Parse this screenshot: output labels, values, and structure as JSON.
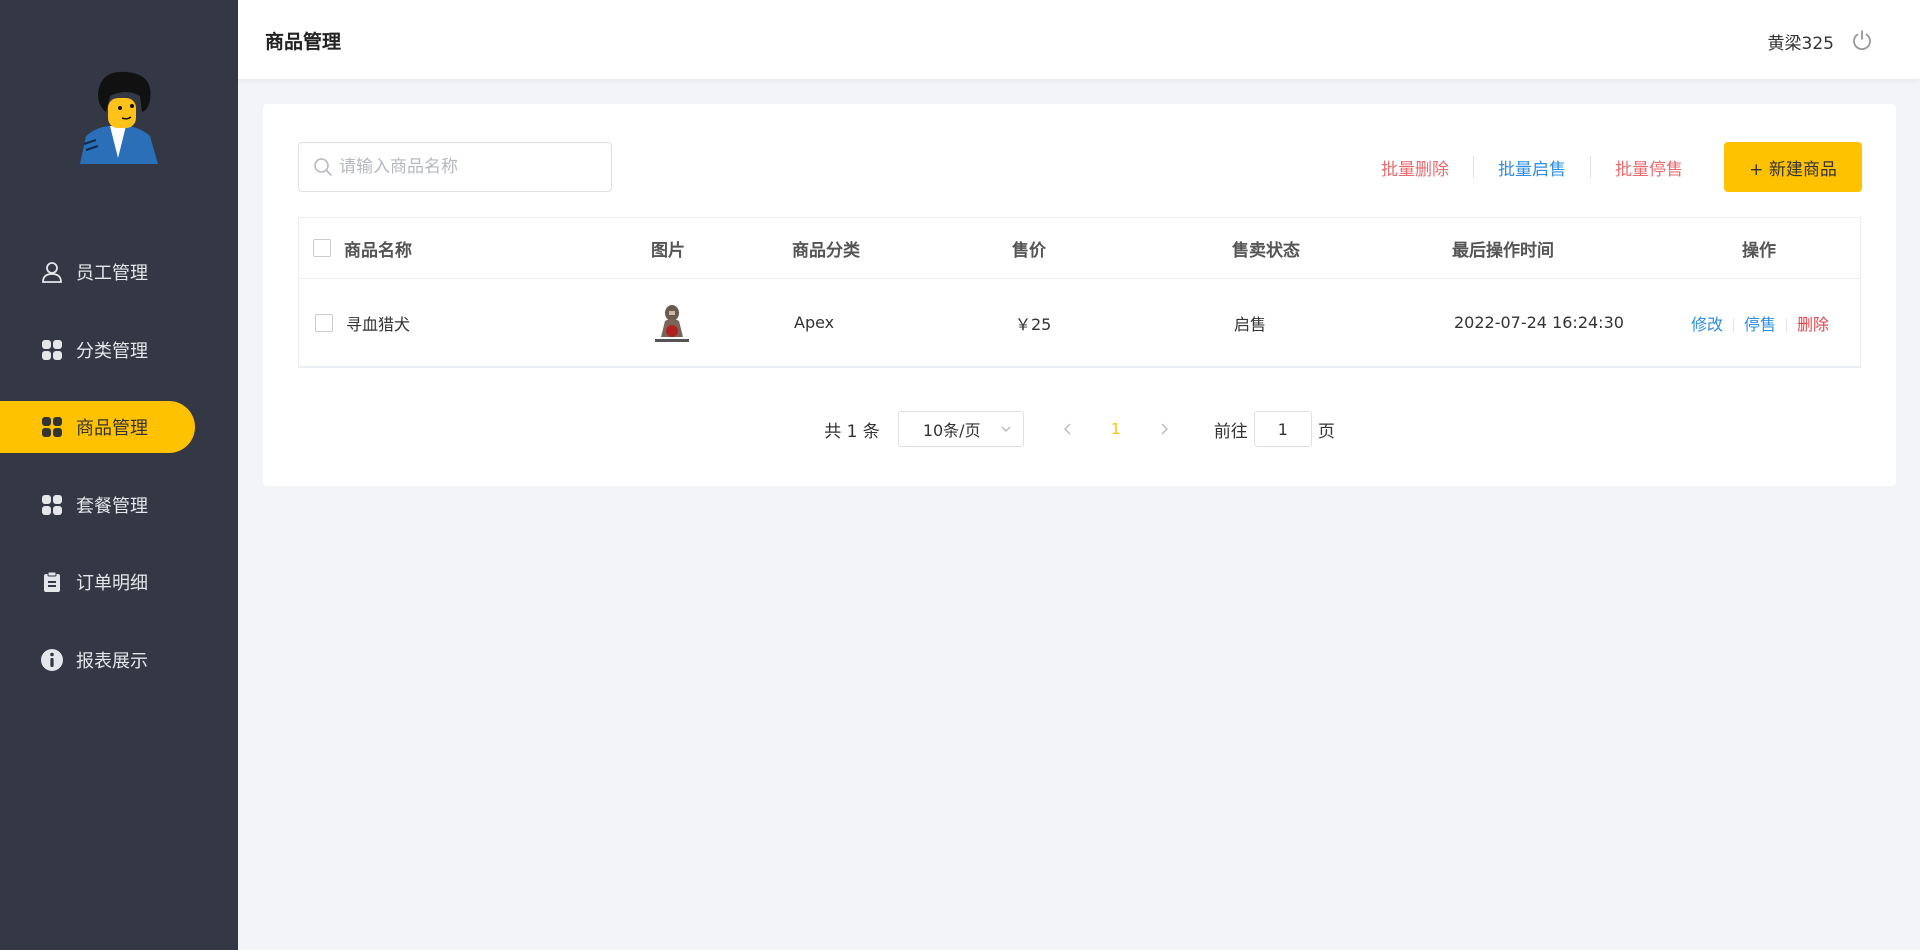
{
  "header": {
    "title": "商品管理",
    "username": "黄梁325"
  },
  "sidebar": {
    "items": [
      {
        "label": "员工管理",
        "icon": "user-icon",
        "active": false
      },
      {
        "label": "分类管理",
        "icon": "grid-icon",
        "active": false
      },
      {
        "label": "商品管理",
        "icon": "grid-icon",
        "active": true
      },
      {
        "label": "套餐管理",
        "icon": "grid-icon",
        "active": false
      },
      {
        "label": "订单明细",
        "icon": "clipboard-icon",
        "active": false
      },
      {
        "label": "报表展示",
        "icon": "info-icon",
        "active": false
      }
    ]
  },
  "search": {
    "placeholder": "请输入商品名称",
    "value": ""
  },
  "actions": {
    "batch_delete": "批量删除",
    "batch_enable": "批量启售",
    "batch_disable": "批量停售",
    "new_item": "+ 新建商品"
  },
  "table": {
    "columns": [
      "商品名称",
      "图片",
      "商品分类",
      "售价",
      "售卖状态",
      "最后操作时间",
      "操作"
    ],
    "rows": [
      {
        "name": "寻血猎犬",
        "category": "Apex",
        "price": "￥25",
        "status": "启售",
        "updated": "2022-07-24 16:24:30",
        "ops": {
          "edit": "修改",
          "toggle": "停售",
          "delete": "删除"
        }
      }
    ]
  },
  "pagination": {
    "total_text": "共 1 条",
    "page_size": "10条/页",
    "current_page": "1",
    "goto_prefix": "前往",
    "goto_value": "1",
    "goto_suffix": "页"
  },
  "colors": {
    "accent": "#ffc200",
    "sidebar_bg": "#343744",
    "link_blue": "#2f8de4",
    "link_red": "#e0474b"
  }
}
